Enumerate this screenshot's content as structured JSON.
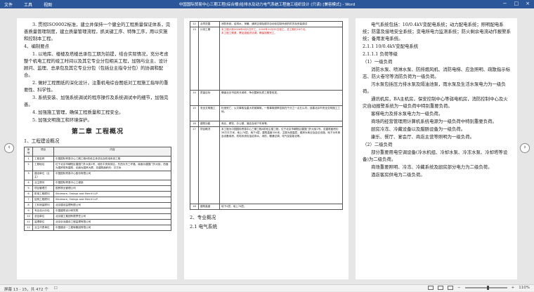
{
  "titlebar": {
    "menus": [
      "文件",
      "工具",
      "视图"
    ],
    "doc_title": "中国国际贸易中心三期工程(综合楼)给排水及动力电气系统工程施工组织设计 (只读) [兼容模式] - Word",
    "controls": [
      "−",
      "□",
      "×"
    ]
  },
  "page1": {
    "p_intro": "3. 贯彻ISO9002标准，建立并保持一个健全的工程质量保证体系，完善质量管理制度，建立质量管理流程，抓关键工序、特殊工序，用以实施和控制本工程。",
    "h_prep": "4、编制要点",
    "items": [
      "1. 以地库、楼楼及塔楼总承包工期为前提，结合实际情况，充分考虑整个机电工程的竣工时间以及其它专业分包相关工程，加强与业主、设计顾问、监理、总承包及其它专业分包（包括业主指令分包）的协调和配合。",
      "2. 做好工程图纸的深化设计，注重机电综合图纸对工程施工指导的重要性、科学性。",
      "3. 系统安装、加强系统调试的程序操作及系统调试中的细节，加强完善。",
      "4. 加强施工管理，确保工程质量和工程安全。",
      "5. 加强文明施工和环境保护。"
    ],
    "chapter": "第二章  工程概况",
    "h_overview": "1、工程建设概况",
    "table_head": [
      "序号",
      "项目",
      "内容"
    ],
    "table_rows": [
      [
        "1",
        "工程名称",
        "中国国际贸易中心三期工程A阶段主体总包及机电系统工程"
      ],
      [
        "2",
        "工程地址",
        "位于北京市朝阳区建国门外大街1号，地处中央商务区。东西为东三环路，南面为建国门外大街，西面为国贸现有建筑，北面为国贸大厦，总建筑面积约：平方米"
      ],
      [
        "3",
        "建设单位（业主）",
        "中国国际贸易中心股份有限公司"
      ],
      [
        "4",
        "业主顾问",
        "中国国际贸易中心工程部"
      ],
      [
        "5",
        "项目管理方",
        "国贸物业管理公司"
      ],
      [
        "6",
        "机电工程顾问",
        "Skidmore, Owings and Merrill LLP"
      ],
      [
        "7",
        "结构工程顾问",
        "Skidmore, Owings and Merrill LLP"
      ],
      [
        "8",
        "工料测量顾问",
        "北京建设监理有限公司"
      ],
      [
        "9",
        "专业设计分包",
        "中国建筑设计研究院"
      ],
      [
        "10",
        "总包单位",
        "北京建工集团有限责任公司"
      ],
      [
        "11",
        "监理单位",
        "北京京远建设工程监理有限公司"
      ],
      [
        "12",
        "业主代表单位",
        "中国建设一工程局集团有限公司"
      ]
    ]
  },
  "page2": {
    "table_rows": [
      [
        "12",
        "合同范围",
        "消防系统、给排水、采暖、通风空调及楼宇自动化控制系统的供货及安装调试"
      ],
      [
        "13",
        "计划工期",
        "本工程计划2008年9月1日开工，2009年12月31日竣工，总工期约16个月。\n本工程工期紧，需加强组织协调，确保按期完工。"
      ],
      [
        "14",
        "质量目标",
        "确保北京市结构长城杯，争创国家优质工程鲁班奖。"
      ],
      [
        "15",
        "安全文明施工",
        "杜绝死亡、火灾事故及重大机械事故，一般事故频率控制在千分之一点五以内；创建北京市安全文明施工工地。"
      ],
      [
        "16",
        "建筑功能",
        "商业、餐饮、办公楼、酒店及地下车库等。"
      ],
      [
        "17",
        "项目概况",
        "本工程为中国国际贸易中心三期工程A阶段主楼工程，位于北京市朝阳区建国门外大街1号。总建筑面积约28万平方米，地上74层，地下4层，建筑高度330米。主楼为超高层，裙房为商业及会议设施，地下为车库及设备用房。机电系统包括给排水、消防、暖通空调、电气及智能化等。"
      ],
      [
        "18",
        "建筑高度",
        "地下4层，地上74层。"
      ]
    ],
    "h_pro": "2、专业概况",
    "h_elec": "2.1 电气系统"
  },
  "page3": {
    "p1": "电气系统包括：10/0.4kV变配电系统；动力配电系统；照明配电系统；防雷及接地安全系统；变电所电力监测系统；防火剩余电流动作报警系统；备用发电系统。",
    "h_a": "2.1.1 10/0.4kV变配电系统",
    "h_b": "2.1.1.1 负荷等级",
    "h_c": "（1）一级负荷",
    "p2": "消防水泵、喷淋水泵、防排烟风机、消防电梯、应急照明、疏散指示标志、防火卷帘等消防负荷为一级负荷。",
    "p3": "污水泵包括压力排水泵及隔油池泵，雨水泵及生活水泵电力为一级负荷。",
    "p4": "通讯机房，BA主机房，保安控制中心等弱电机房，消防控制中心及火灾自动报警系统为一级负荷中特别重要负荷。",
    "p5": "客梯电力及排水泵电力为一级负荷。",
    "p6": "商场的经营管理用计算机系统电源为一级负荷中特别重要负荷。",
    "p7": "厨房冷冻、冷藏设备以及腊肠设备为一级负荷。",
    "p8": "康乐、餐厅、宴会厅、商店主营等照明为一级负荷。",
    "h_d": "（2）二级负荷",
    "p9": "部分重要用电空调设备(冷水机组、冷却水泵、冷冻水泵、冷却塔等设备)为二级负荷。",
    "p10": "商场重要照明、冷冻、冷藏系统及厨房部分电力为二级负荷。",
    "p11": "酒店客房供电为二级负荷。"
  },
  "statusbar": {
    "page": "屏幕 13 - 15，共 472 个",
    "lang_icon": "☐",
    "zoom": "110%",
    "zoom_level": 0.55
  }
}
